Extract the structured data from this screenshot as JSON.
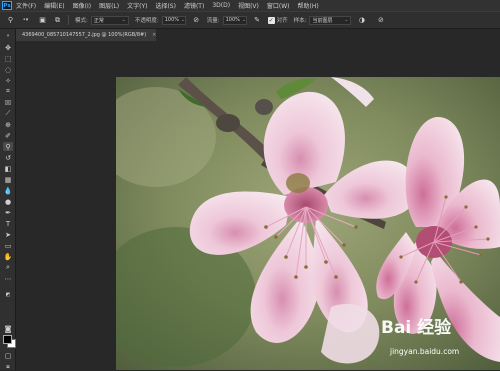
{
  "app": {
    "logo": "Ps"
  },
  "menu": [
    "文件(F)",
    "编辑(E)",
    "图像(I)",
    "图层(L)",
    "文字(Y)",
    "选择(S)",
    "滤镜(T)",
    "3D(D)",
    "视图(V)",
    "窗口(W)",
    "帮助(H)"
  ],
  "options": {
    "mode_label": "模式:",
    "mode_value": "正常",
    "opacity_label": "不透明度:",
    "opacity_value": "100%",
    "flow_label": "流量:",
    "flow_value": "100%",
    "aligned_label": "对齐",
    "sample_label": "样本:",
    "sample_value": "当前图层"
  },
  "document_tab": {
    "title": "4369400_085710147557_2.jpg @ 100%(RGB/8#)",
    "close": "×"
  },
  "watermark": {
    "brand": "Bai 经验",
    "url": "jingyan.baidu.com"
  },
  "colors": {
    "foreground": "#000000",
    "background": "#ffffff"
  }
}
